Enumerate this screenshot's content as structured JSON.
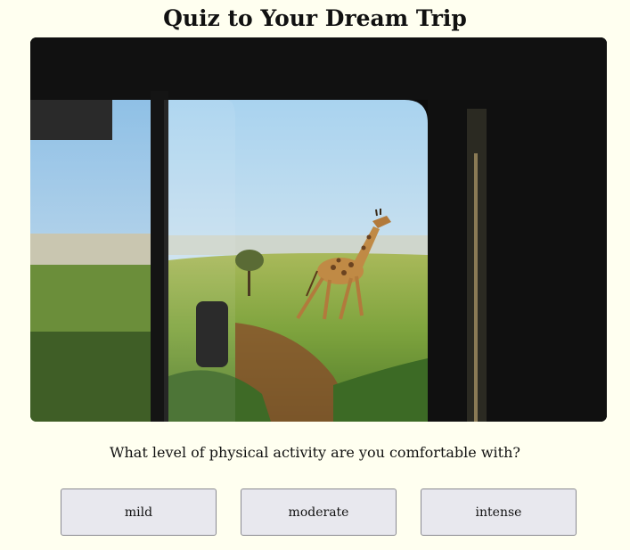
{
  "page": {
    "title": "Quiz to Your Dream Trip"
  },
  "hero_image": {
    "subject": "giraffe-viewed-from-safari-vehicle-window"
  },
  "quiz": {
    "question": "What level of physical activity are you comfortable with?",
    "options": [
      {
        "label": "mild"
      },
      {
        "label": "moderate"
      },
      {
        "label": "intense"
      }
    ]
  },
  "colors": {
    "page_background": "#fffff0",
    "button_background": "#e8e8ee",
    "button_border": "#8a8a92",
    "text": "#111111"
  }
}
